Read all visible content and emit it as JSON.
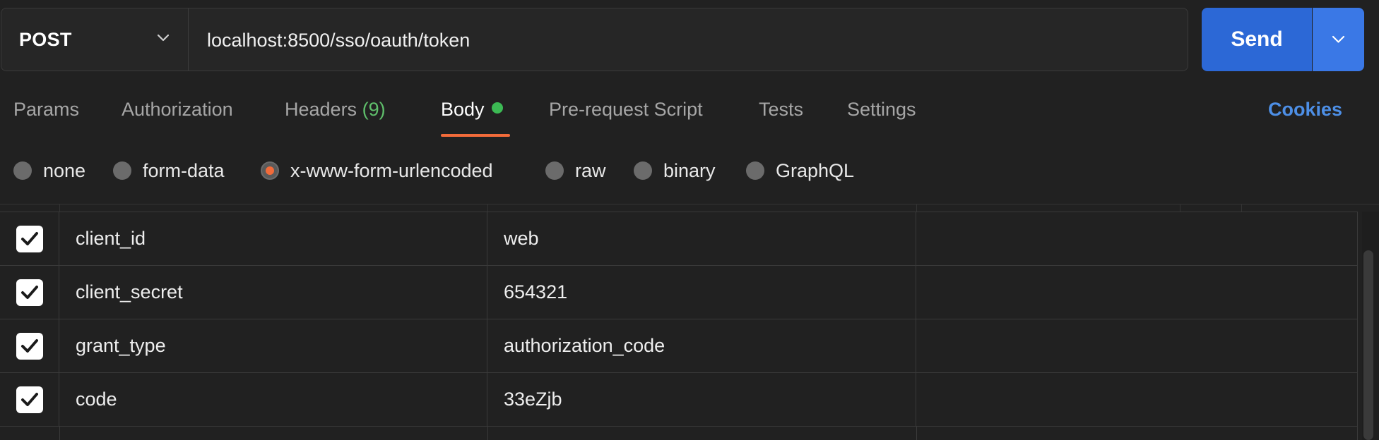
{
  "request": {
    "method": "POST",
    "url": "localhost:8500/sso/oauth/token",
    "send_label": "Send"
  },
  "tabs": [
    {
      "label": "Params"
    },
    {
      "label": "Authorization"
    },
    {
      "label": "Headers",
      "count": "(9)"
    },
    {
      "label": "Body",
      "active": true
    },
    {
      "label": "Pre-request Script"
    },
    {
      "label": "Tests"
    },
    {
      "label": "Settings"
    }
  ],
  "cookies_label": "Cookies",
  "body_types": [
    {
      "label": "none",
      "selected": false
    },
    {
      "label": "form-data",
      "selected": false
    },
    {
      "label": "x-www-form-urlencoded",
      "selected": true
    },
    {
      "label": "raw",
      "selected": false
    },
    {
      "label": "binary",
      "selected": false
    },
    {
      "label": "GraphQL",
      "selected": false
    }
  ],
  "params": [
    {
      "checked": true,
      "key": "client_id",
      "value": "web",
      "description": ""
    },
    {
      "checked": true,
      "key": "client_secret",
      "value": "654321",
      "description": ""
    },
    {
      "checked": true,
      "key": "grant_type",
      "value": "authorization_code",
      "description": ""
    },
    {
      "checked": true,
      "key": "code",
      "value": "33eZjb",
      "description": ""
    }
  ],
  "colors": {
    "accent_orange": "#f26b3a",
    "send_blue": "#2c68d6",
    "cookies_blue": "#4d8fe6",
    "body_dot_green": "#3cba54",
    "header_count_green": "#5fbf6b",
    "background": "#212121"
  },
  "icons": {
    "method_dropdown": "chevron-down-icon",
    "send_dropdown": "chevron-down-icon",
    "checkbox": "checkmark-icon"
  }
}
